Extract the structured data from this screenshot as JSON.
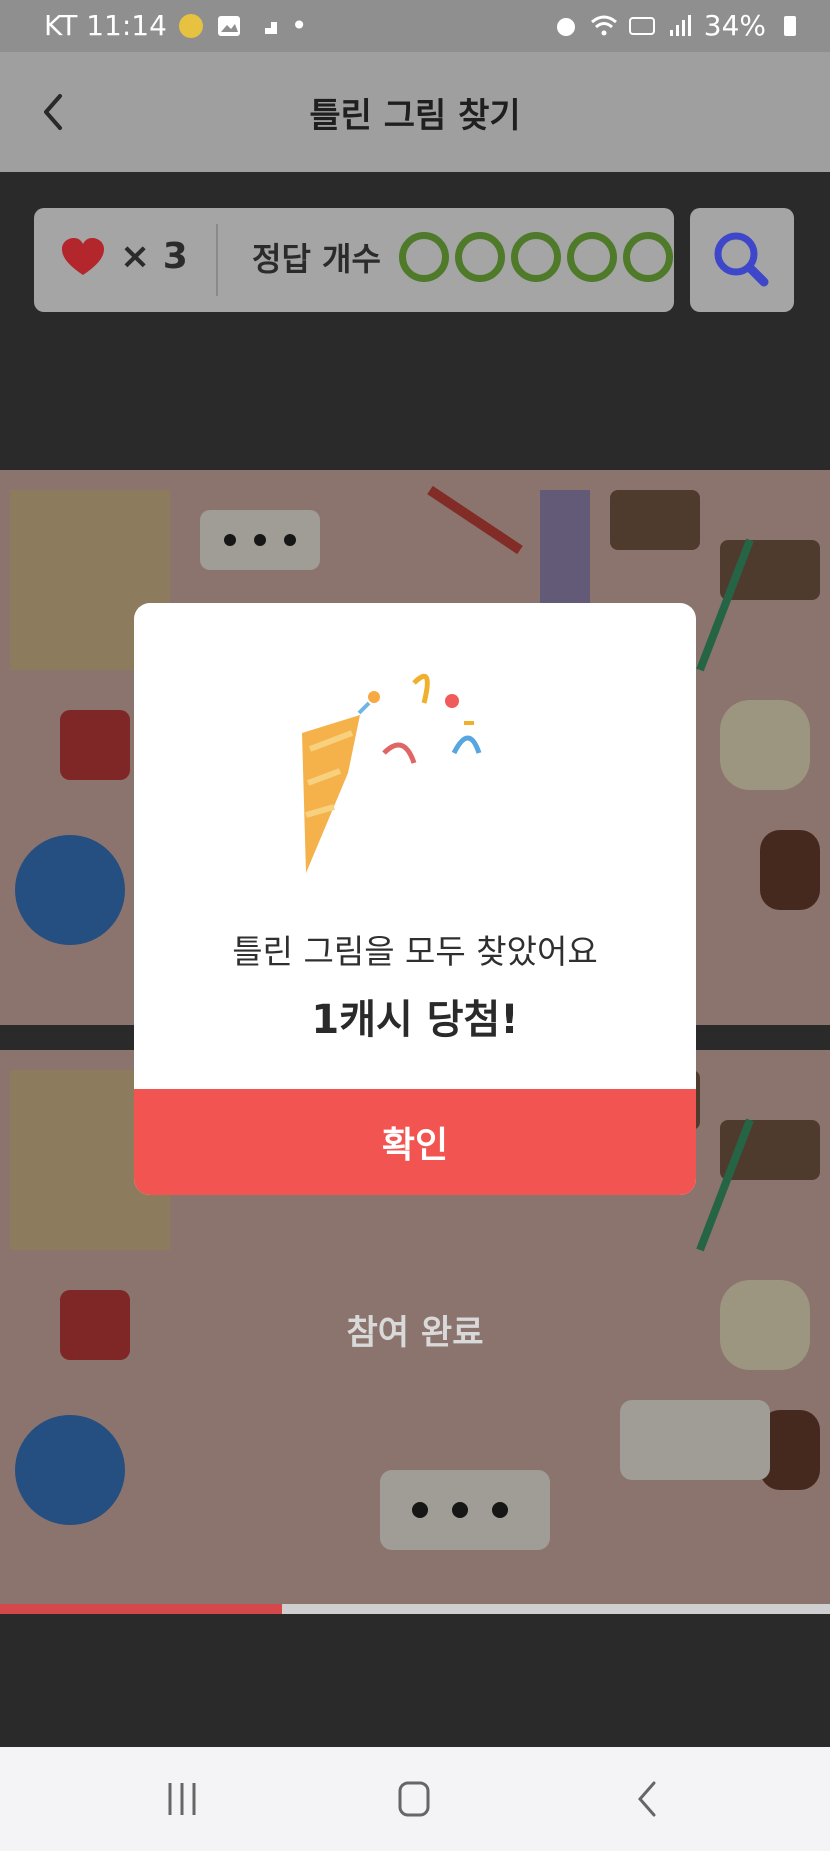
{
  "status": {
    "carrier_time": "KT 11:14",
    "battery": "34%"
  },
  "header": {
    "title": "틀린 그림 찾기"
  },
  "game": {
    "lives_label": "× 3",
    "answers_label": "정답 개수",
    "answer_total": 5
  },
  "puzzle": {
    "done_label": "참여 완료",
    "progress": 0.34
  },
  "modal": {
    "message": "틀린 그림을 모두 찾았어요",
    "reward": "1캐시 당첨!",
    "confirm": "확인"
  },
  "colors": {
    "accent": "#f25452",
    "answer_ring": "#4e7a2a",
    "heart": "#b3262c",
    "search": "#3e47c9"
  }
}
